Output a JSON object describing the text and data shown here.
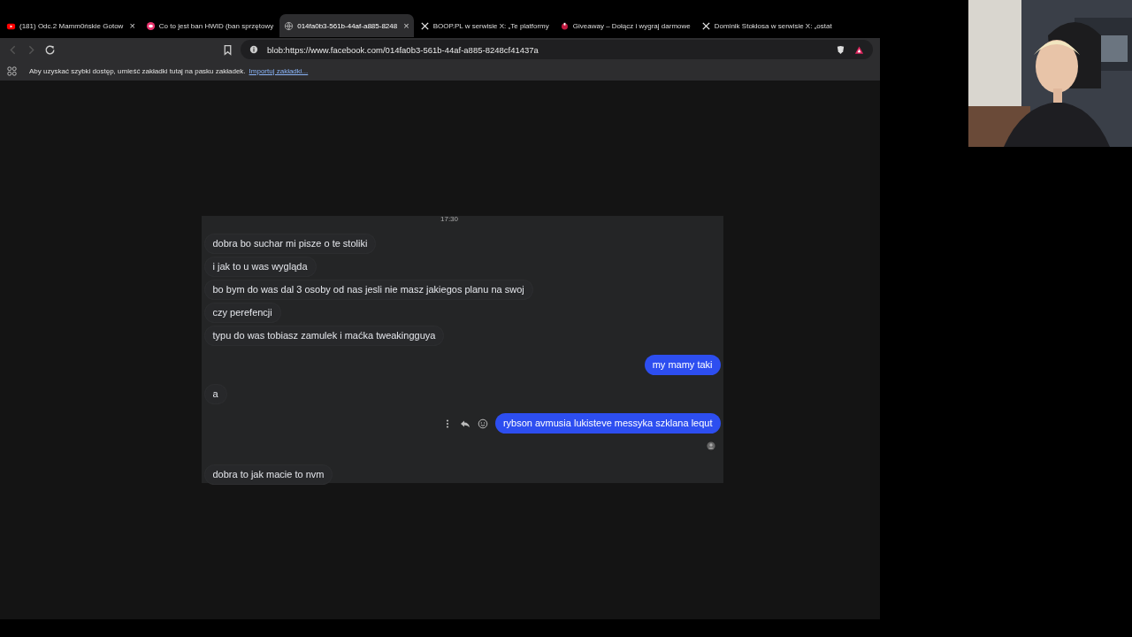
{
  "tabs": [
    {
      "title": "(181) Odc.2 Mamm0ńskie Gotow",
      "kind": "video",
      "close": "×",
      "selected": false
    },
    {
      "title": "Co to jest ban HWID (ban sprzętowy",
      "kind": "article",
      "selected": false
    },
    {
      "title": "014fa0b3-561b-44af-a885-8248",
      "kind": "web",
      "close": "×",
      "selected": true
    },
    {
      "title": "BOOP.PL w serwisie X: „Te platformy",
      "kind": "post",
      "selected": false
    },
    {
      "title": "Giveaway – Dołącz i wygraj darmowe",
      "kind": "gift",
      "selected": false
    },
    {
      "title": "Dominik Stokłosa w serwisie X: „ostat",
      "kind": "post",
      "selected": false
    }
  ],
  "address_bar": {
    "url": "blob:https://www.facebook.com/014fa0b3-561b-44af-a885-8248cf41437a"
  },
  "bookmarks_bar": {
    "hint": "Aby uzyskać szybki dostęp, umieść zakładki tutaj na pasku zakładek.",
    "link": "Importuj zakładki..."
  },
  "chat": {
    "time": "17:30",
    "messages": [
      {
        "text": "dobra bo suchar mi pisze o te stoliki",
        "kind": "incoming"
      },
      {
        "text": "i jak to u was wygląda",
        "kind": "incoming"
      },
      {
        "text": "bo bym do was dal 3 osoby od nas jesli nie masz jakiegos planu na swoj",
        "kind": "incoming"
      },
      {
        "text": "czy perefencji",
        "kind": "incoming"
      },
      {
        "text": "typu do was tobiasz zamulek i maćka tweakingguya",
        "kind": "incoming"
      },
      {
        "text": "my mamy taki",
        "kind": "outgoing"
      },
      {
        "text": "a",
        "kind": "incoming"
      },
      {
        "text": "rybson avmusia lukisteve messyka szklana lequt",
        "kind": "outgoing",
        "actions": true,
        "seen": true
      },
      {
        "text": "dobra to jak macie to nvm",
        "kind": "incoming"
      }
    ]
  }
}
